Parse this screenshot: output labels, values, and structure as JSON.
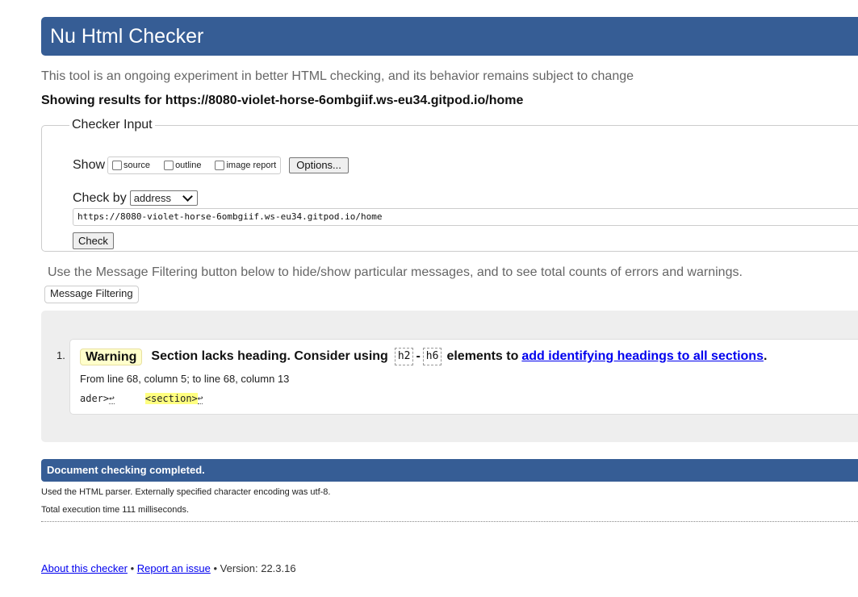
{
  "header": {
    "title": "Nu Html Checker"
  },
  "tagline": "This tool is an ongoing experiment in better HTML checking, and its behavior remains subject to change",
  "results_for": "Showing results for https://8080-violet-horse-6ombgiif.ws-eu34.gitpod.io/home",
  "checker_input": {
    "legend": "Checker Input",
    "show_label": "Show",
    "options": {
      "source": "source",
      "outline": "outline",
      "image_report": "image report"
    },
    "options_button": "Options...",
    "check_by_label": "Check by",
    "check_by_value": "address",
    "url_value": "https://8080-violet-horse-6ombgiif.ws-eu34.gitpod.io/home",
    "check_button": "Check"
  },
  "filter": {
    "hint": "Use the Message Filtering button below to hide/show particular messages, and to see total counts of errors and warnings.",
    "button": "Message Filtering"
  },
  "messages": [
    {
      "number": "1.",
      "type": "Warning",
      "text_before": "Section lacks heading. Consider using",
      "code_start": "h2",
      "dash": "-",
      "code_end": "h6",
      "text_middle": "elements to",
      "link_text": "add identifying headings to all sections",
      "text_after": ".",
      "location": "From line 68, column 5; to line 68, column 13",
      "extract_before": "ader>",
      "extract_highlight": "<section>",
      "linefeed": "↩"
    }
  ],
  "completed": "Document checking completed.",
  "parser_note": "Used the HTML parser. Externally specified character encoding was utf-8.",
  "exec_time": "Total execution time 111 milliseconds.",
  "footer": {
    "about": "About this checker",
    "sep": "•",
    "report": "Report an issue",
    "version": "Version: 22.3.16"
  }
}
